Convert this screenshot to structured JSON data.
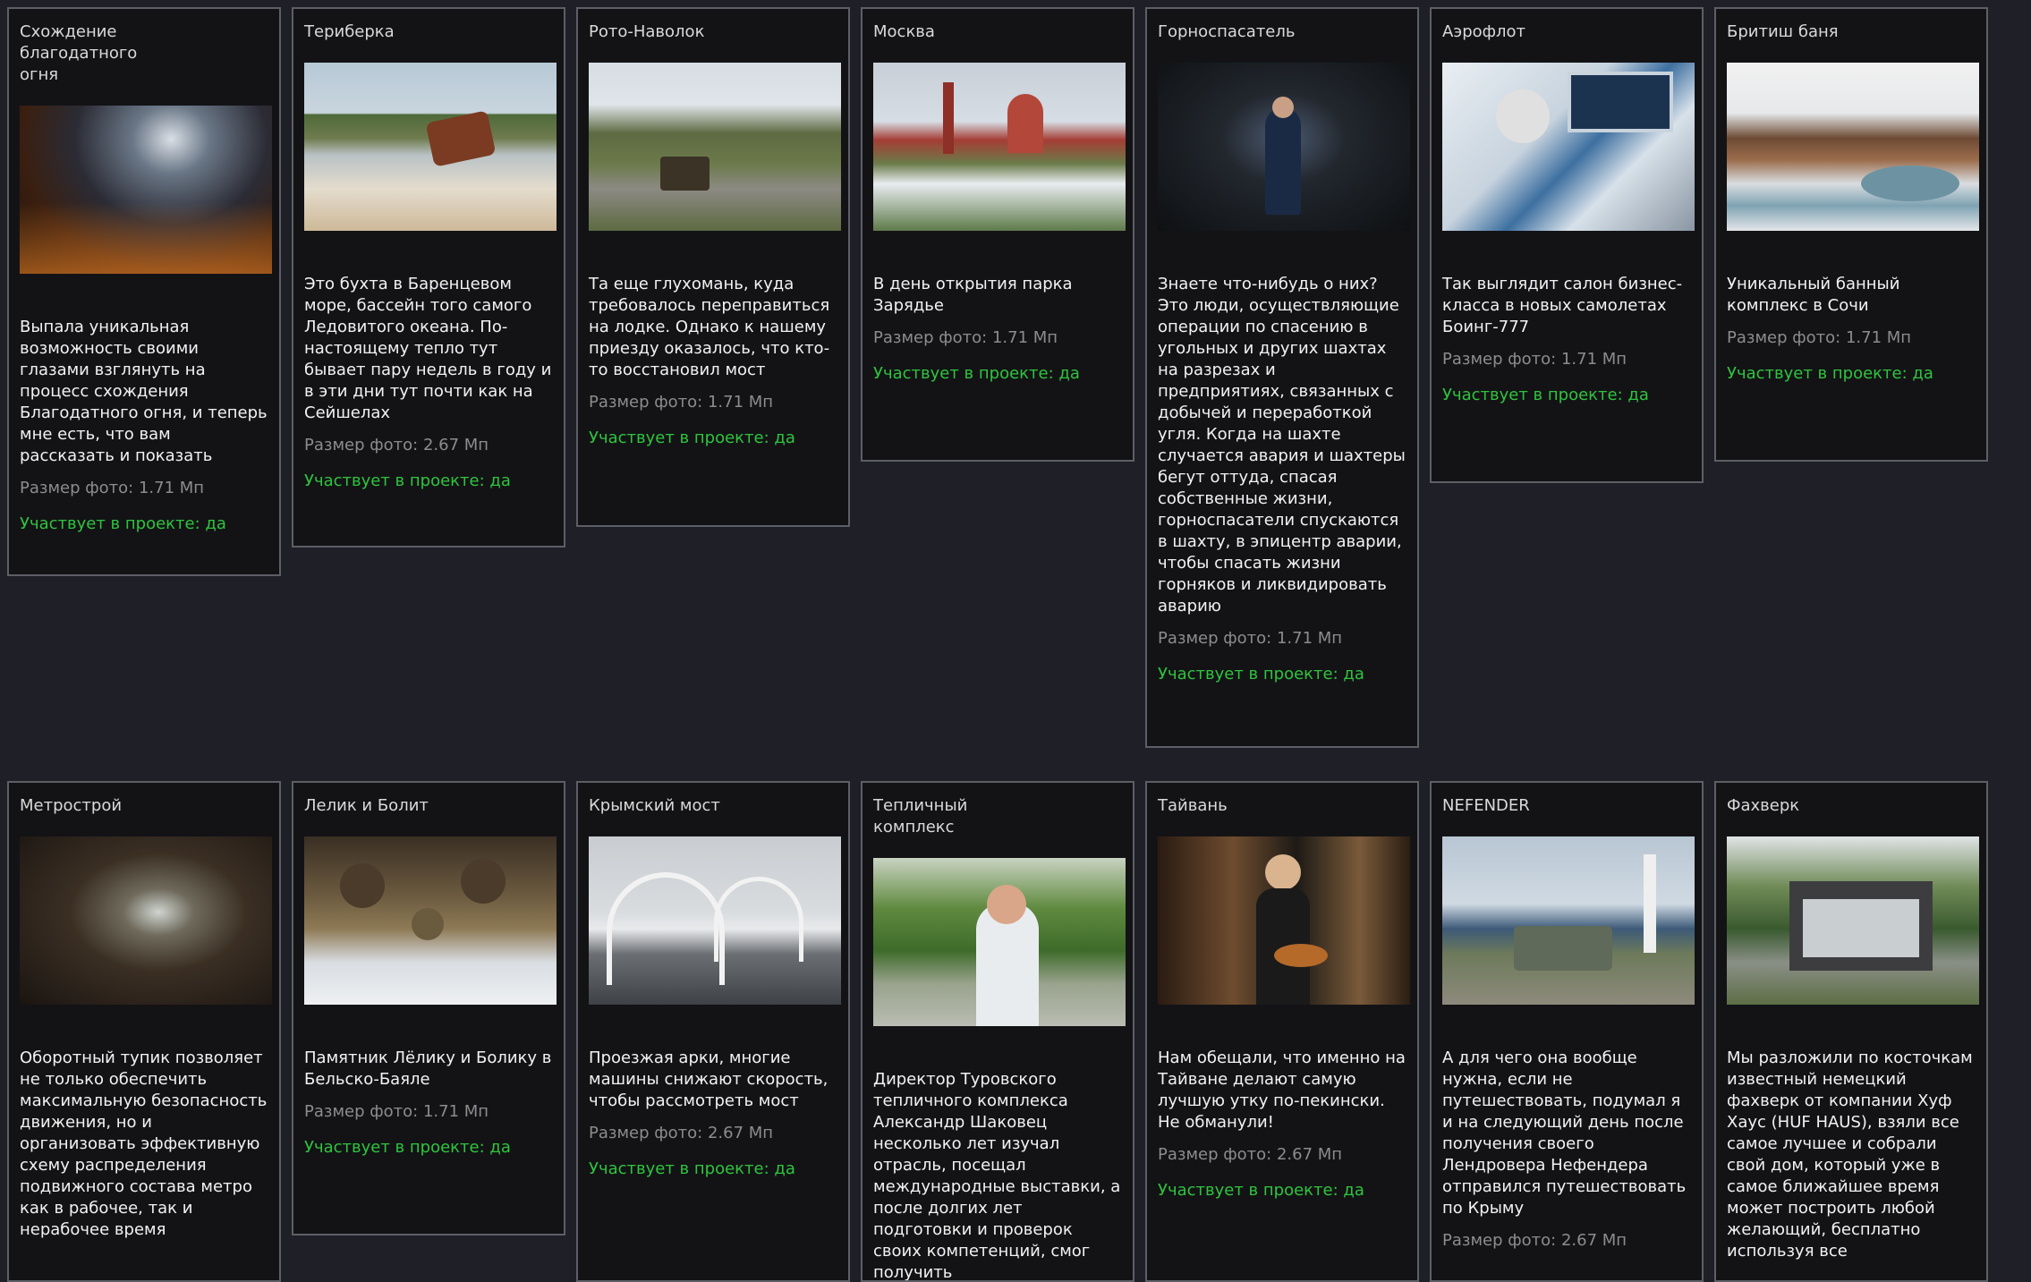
{
  "cards": [
    {
      "title": "Схождение благодатного огня",
      "description": "Выпала уникальная возможность своими глазами взглянуть на процесс схождения Благодатного огня, и теперь мне есть, что вам рассказать и показать",
      "size": "Размер фото: 1.71 Мп",
      "participates": "Участвует в проекте: да"
    },
    {
      "title": "Териберка",
      "description": "Это бухта в Баренцевом море, бассейн того самого Ледовитого океана. По-настоящему тепло тут бывает пару недель в году и в эти дни тут почти как на Сейшелах",
      "size": "Размер фото: 2.67 Мп",
      "participates": "Участвует в проекте: да"
    },
    {
      "title": "Рото-Наволок",
      "description": "Та еще глухомань, куда требовалось переправиться на лодке. Однако к нашему приезду оказалось, что кто-то восстановил мост",
      "size": "Размер фото: 1.71 Мп",
      "participates": "Участвует в проекте: да"
    },
    {
      "title": "Москва",
      "description": "В день открытия парка Зарядье",
      "size": "Размер фото: 1.71 Мп",
      "participates": "Участвует в проекте: да"
    },
    {
      "title": "Горноспасатель",
      "description": "Знаете что-нибудь о них?  Это люди, осуществляющие операции по спасению в угольных и других шахтах на разрезах и предприятиях, связанных с добычей и переработкой угля. Когда на шахте случается авария и шахтеры бегут оттуда, спасая собственные жизни, горноспасатели спускаются в шахту, в эпицентр аварии, чтобы спасать жизни горняков и ликвидировать аварию",
      "size": "Размер фото: 1.71 Мп",
      "participates": "Участвует в проекте: да"
    },
    {
      "title": "Аэрофлот",
      "description": "Так выглядит салон бизнес-класса в новых самолетах Боинг-777",
      "size": "Размер фото: 1.71 Мп",
      "participates": "Участвует в проекте: да"
    },
    {
      "title": "Бритиш баня",
      "description": "Уникальный банный комплекс в Сочи",
      "size": "Размер фото: 1.71 Мп",
      "participates": "Участвует в проекте: да"
    },
    {
      "title": "Метрострой",
      "description": "Оборотный тупик позволяет не только обеспечить максимальную безопасность движения, но и организовать эффективную схему распределения подвижного состава метро как в рабочее, так и нерабочее время",
      "size": "",
      "participates": ""
    },
    {
      "title": "Лелик и Болит",
      "description": "Памятник Лёлику и Болику в Бельско-Баяле",
      "size": "Размер фото: 1.71 Мп",
      "participates": "Участвует в проекте: да"
    },
    {
      "title": "Крымский мост",
      "description": "Проезжая арки, многие машины снижают скорость, чтобы рассмотреть мост",
      "size": "Размер фото: 2.67 Мп",
      "participates": "Участвует в проекте: да"
    },
    {
      "title": "Тепличный комплекс",
      "description": "Директор Туровского тепличного комплекса Александр Шаковец несколько лет изучал отрасль, посещал международные выставки, а после долгих лет подготовки и проверок своих компетенций, смог получить",
      "size": "",
      "participates": ""
    },
    {
      "title": "Тайвань",
      "description": "Нам обещали, что именно на Тайване делают самую лучшую утку по-пекински. Не обманули!",
      "size": "Размер фото: 2.67 Мп",
      "participates": "Участвует в проекте: да"
    },
    {
      "title": "NEFENDER",
      "description": "А для чего она вообще нужна, если не путешествовать, подумал я и на следующий день после получения своего Лендровера Нефендера отправился путешествовать по Крыму",
      "size": "Размер фото: 2.67 Мп",
      "participates": ""
    },
    {
      "title": "Фахверк",
      "description": "Мы разложили по косточкам известный немецкий фахверк от компании Хуф Хаус (HUF HAUS), взяли все самое лучшее и собрали свой дом, который уже в самое ближайшее время может построить любой желающий, бесплатно используя все",
      "size": "",
      "participates": ""
    }
  ]
}
